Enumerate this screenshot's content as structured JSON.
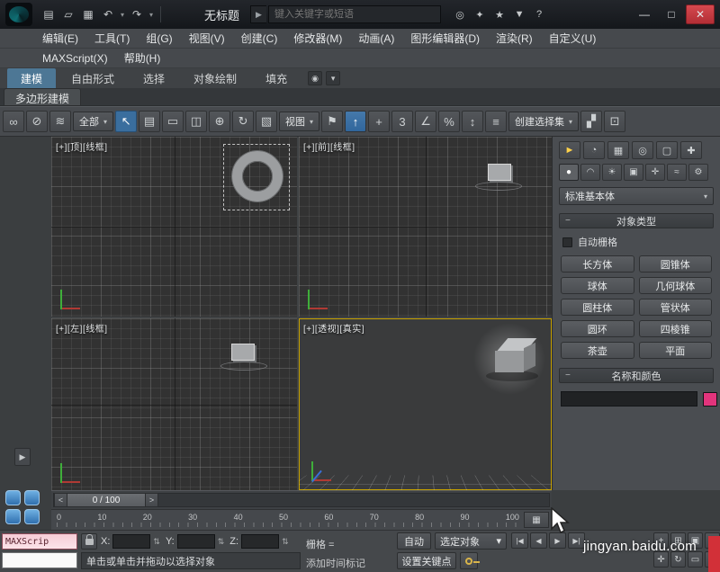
{
  "titlebar": {
    "title": "无标题",
    "search_placeholder": "键入关键字或短语"
  },
  "menus": {
    "row1": [
      "编辑(E)",
      "工具(T)",
      "组(G)",
      "视图(V)",
      "创建(C)",
      "修改器(M)",
      "动画(A)",
      "图形编辑器(D)",
      "渲染(R)",
      "自定义(U)"
    ],
    "row2": [
      "MAXScript(X)",
      "帮助(H)"
    ]
  },
  "ribbon": {
    "tabs": [
      "建模",
      "自由形式",
      "选择",
      "对象绘制",
      "填充"
    ],
    "subtab": "多边形建模"
  },
  "toolbar": {
    "filter": "全部",
    "view": "视图",
    "snap": "3",
    "selset": "创建选择集"
  },
  "viewports": {
    "top": "[+][顶][线框]",
    "front": "[+][前][线框]",
    "left": "[+][左][线框]",
    "persp": "[+][透视][真实]"
  },
  "panel": {
    "category": "标准基本体",
    "object_type": "对象类型",
    "autogrid": "自动栅格",
    "buttons": [
      "长方体",
      "圆锥体",
      "球体",
      "几何球体",
      "圆柱体",
      "管状体",
      "圆环",
      "四棱锥",
      "茶壶",
      "平面"
    ],
    "name_color": "名称和颜色",
    "swatch_color": "#e2347c",
    "swatch_style": "background-color:#e2347c"
  },
  "timeline": {
    "thumb": "0 / 100",
    "ticks": [
      "0",
      "10",
      "20",
      "30",
      "40",
      "50",
      "60",
      "70",
      "80",
      "90",
      "100"
    ]
  },
  "status": {
    "maxscript": "MAXScrip",
    "prompt": "单击或单击并拖动以选择对象",
    "add_time_tag": "添加时间标记",
    "grid": "栅格 =",
    "x": "X:",
    "y": "Y:",
    "z": "Z:",
    "auto": "自动",
    "selected": "选定对象",
    "set_key": "设置关键点",
    "watermark": "jingyan.baidu.com"
  },
  "glyphs": {
    "new": "▤",
    "open": "▱",
    "save": "▦",
    "undo": "↶",
    "redo": "↷",
    "caret": "▾",
    "go": "▶",
    "min": "—",
    "max": "□",
    "close": "✕",
    "people": "◎",
    "key": "✦",
    "star": "★",
    "down": "▼",
    "help": "?",
    "link": "∞",
    "unlink": "⊘",
    "bindw": "≋",
    "cursor": "↖",
    "byname": "▤",
    "marquee": "▭",
    "crossing": "◫",
    "move": "⊕",
    "rotate": "↻",
    "scale": "▧",
    "flag": "⚑",
    "pivot": "↑",
    "manip": "+",
    "angle": "∠",
    "percent": "%",
    "spin": "↕",
    "named": "≡",
    "mirror": "▞",
    "alignb": "⊡",
    "layers": "▤",
    "curve": "~",
    "ribdot": "◉",
    "t1": "►",
    "t2": "◔",
    "t3": "▦",
    "t4": "◎",
    "t5": "▢",
    "t6": "✚",
    "c1": "●",
    "c2": "◠",
    "c3": "☀",
    "c4": "▣",
    "c5": "✛",
    "c6": "≈",
    "c7": "⚙",
    "minus": "−",
    "tleft": "<",
    "tright": ">",
    "p1": "|◀",
    "p2": "◀",
    "p3": "▶",
    "p4": "▶|",
    "n1": "+",
    "n2": "⊞",
    "n3": "▣",
    "n4": "◇",
    "n5": "✛",
    "n6": "↻",
    "n7": "▭",
    "n8": "⊡",
    "tbend": "▦",
    "gutter": "▶",
    "spinner": "⇅"
  }
}
